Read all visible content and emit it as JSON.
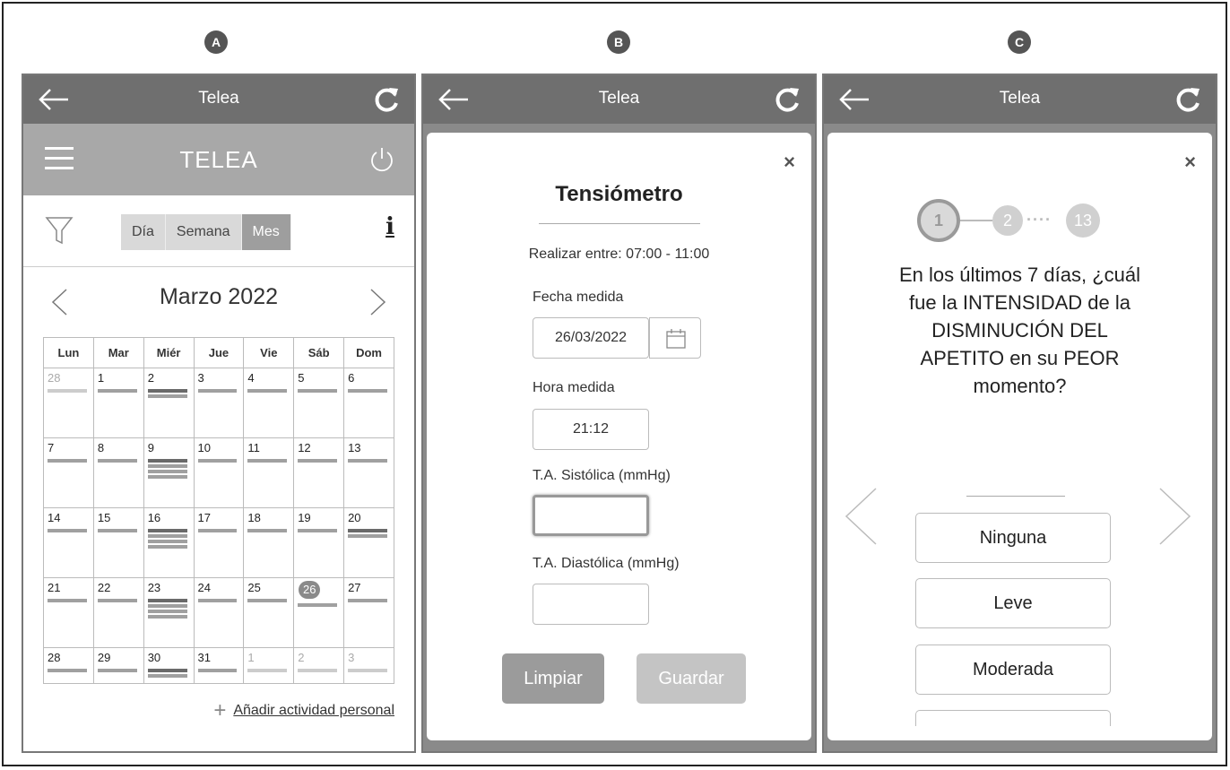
{
  "badges": [
    "A",
    "B",
    "C"
  ],
  "appbar": {
    "title": "Telea"
  },
  "calendar": {
    "header_title": "TELEA",
    "view_tabs": [
      "Día",
      "Semana",
      "Mes"
    ],
    "active_view": "Mes",
    "info_label": "i",
    "month_label": "Marzo 2022",
    "weekdays": [
      "Lun",
      "Mar",
      "Miér",
      "Jue",
      "Vie",
      "Sáb",
      "Dom"
    ],
    "weeks": [
      [
        {
          "d": "28",
          "muted": true,
          "bars": [
            "light"
          ]
        },
        {
          "d": "1",
          "bars": [
            "mid"
          ]
        },
        {
          "d": "2",
          "bars": [
            "dark",
            "mid"
          ]
        },
        {
          "d": "3",
          "bars": [
            "mid"
          ]
        },
        {
          "d": "4",
          "bars": [
            "mid"
          ]
        },
        {
          "d": "5",
          "bars": [
            "mid"
          ]
        },
        {
          "d": "6",
          "bars": [
            "mid"
          ]
        }
      ],
      [
        {
          "d": "7",
          "bars": [
            "mid"
          ]
        },
        {
          "d": "8",
          "bars": [
            "mid"
          ]
        },
        {
          "d": "9",
          "bars": [
            "dark",
            "mid",
            "mid",
            "mid"
          ]
        },
        {
          "d": "10",
          "bars": [
            "mid"
          ]
        },
        {
          "d": "11",
          "bars": [
            "mid"
          ]
        },
        {
          "d": "12",
          "bars": [
            "mid"
          ]
        },
        {
          "d": "13",
          "bars": [
            "mid"
          ]
        }
      ],
      [
        {
          "d": "14",
          "bars": [
            "mid"
          ]
        },
        {
          "d": "15",
          "bars": [
            "mid"
          ]
        },
        {
          "d": "16",
          "bars": [
            "dark",
            "mid",
            "mid",
            "mid"
          ]
        },
        {
          "d": "17",
          "bars": [
            "mid"
          ]
        },
        {
          "d": "18",
          "bars": [
            "mid"
          ]
        },
        {
          "d": "19",
          "bars": [
            "mid"
          ]
        },
        {
          "d": "20",
          "bars": [
            "dark",
            "mid"
          ]
        }
      ],
      [
        {
          "d": "21",
          "bars": [
            "mid"
          ]
        },
        {
          "d": "22",
          "bars": [
            "mid"
          ]
        },
        {
          "d": "23",
          "bars": [
            "dark",
            "mid",
            "mid",
            "mid"
          ]
        },
        {
          "d": "24",
          "bars": [
            "mid"
          ]
        },
        {
          "d": "25",
          "bars": [
            "mid"
          ]
        },
        {
          "d": "26",
          "today": true,
          "bars": [
            "mid"
          ]
        },
        {
          "d": "27",
          "bars": [
            "mid"
          ]
        }
      ],
      [
        {
          "d": "28",
          "bars": [
            "mid"
          ]
        },
        {
          "d": "29",
          "bars": [
            "mid"
          ]
        },
        {
          "d": "30",
          "bars": [
            "dark",
            "mid"
          ]
        },
        {
          "d": "31",
          "bars": [
            "mid"
          ]
        },
        {
          "d": "1",
          "muted": true,
          "bars": [
            "light"
          ]
        },
        {
          "d": "2",
          "muted": true,
          "bars": [
            "light"
          ]
        },
        {
          "d": "3",
          "muted": true,
          "bars": [
            "light"
          ]
        }
      ]
    ],
    "add_activity": "Añadir actividad personal"
  },
  "form": {
    "close": "×",
    "title": "Tensiómetro",
    "window": "Realizar entre: 07:00 - 11:00",
    "date_label": "Fecha medida",
    "date_value": "26/03/2022",
    "time_label": "Hora medida",
    "time_value": "21:12",
    "systolic_label": "T.A. Sistólica (mmHg)",
    "systolic_value": "",
    "diastolic_label": "T.A. Diastólica (mmHg)",
    "diastolic_value": "",
    "clear_label": "Limpiar",
    "save_label": "Guardar"
  },
  "questionnaire": {
    "close": "×",
    "steps": [
      "1",
      "2",
      "13"
    ],
    "question": "En los últimos 7 días, ¿cuál fue la INTENSIDAD de la DISMINUCIÓN DEL APETITO en su PEOR momento?",
    "options": [
      "Ninguna",
      "Leve",
      "Moderada"
    ]
  },
  "colors": {
    "appbar": "#6f6f6f",
    "header": "#a8a8a8",
    "active_tab": "#9e9e9e",
    "modal_overlay": "#8a8a8a"
  }
}
